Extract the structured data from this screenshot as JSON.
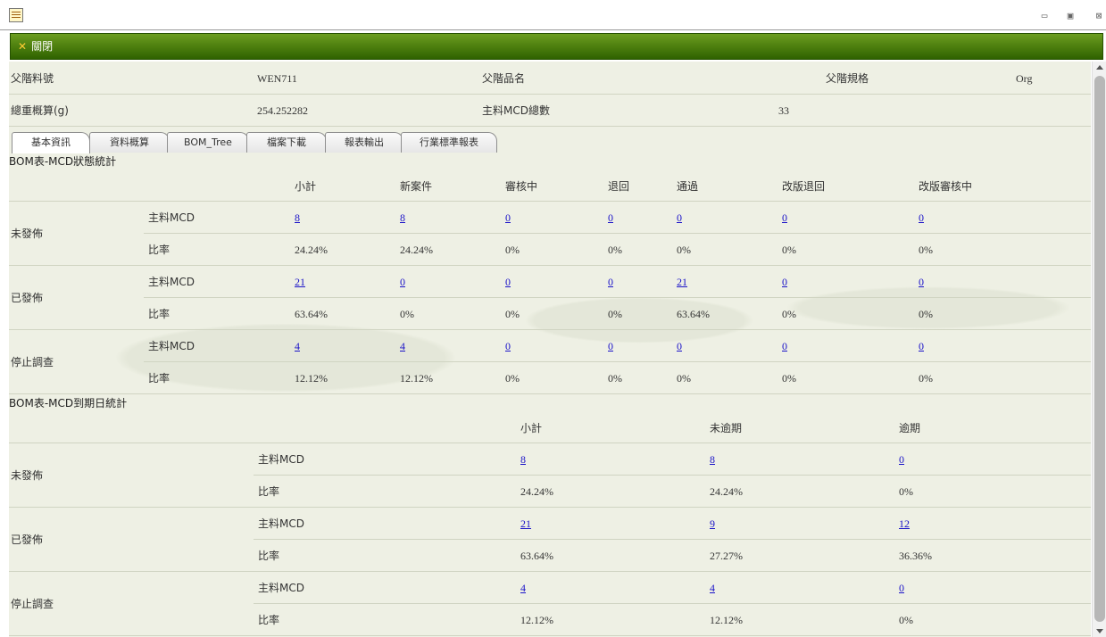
{
  "window": {
    "close_label": "關閉",
    "controls": [
      "pin-icon",
      "restore-icon",
      "close-window-icon"
    ]
  },
  "header": {
    "parent_part_no_label": "父階料號",
    "parent_part_no": "WEN711",
    "parent_part_name_label": "父階品名",
    "parent_spec_label": "父階規格",
    "org": "Org",
    "total_weight_label": "總重概算(g)",
    "total_weight": "254.252282",
    "mcd_total_label": "主料MCD總數",
    "mcd_total": "33"
  },
  "tabs": [
    "基本資訊",
    "資料概算",
    "BOM_Tree",
    "檔案下載",
    "報表輸出",
    "行業標準報表"
  ],
  "status_table": {
    "title": "BOM表-MCD狀態統計",
    "columns": [
      "小計",
      "新案件",
      "審核中",
      "退回",
      "通過",
      "改版退回",
      "改版審核中"
    ],
    "groups": [
      {
        "label": "未發佈",
        "mcd_label": "主料MCD",
        "mcd": [
          "8",
          "8",
          "0",
          "0",
          "0",
          "0",
          "0"
        ],
        "ratio_label": "比率",
        "ratio": [
          "24.24%",
          "24.24%",
          "0%",
          "0%",
          "0%",
          "0%",
          "0%"
        ]
      },
      {
        "label": "已發佈",
        "mcd_label": "主料MCD",
        "mcd": [
          "21",
          "0",
          "0",
          "0",
          "21",
          "0",
          "0"
        ],
        "ratio_label": "比率",
        "ratio": [
          "63.64%",
          "0%",
          "0%",
          "0%",
          "63.64%",
          "0%",
          "0%"
        ]
      },
      {
        "label": "停止調查",
        "mcd_label": "主料MCD",
        "mcd": [
          "4",
          "4",
          "0",
          "0",
          "0",
          "0",
          "0"
        ],
        "ratio_label": "比率",
        "ratio": [
          "12.12%",
          "12.12%",
          "0%",
          "0%",
          "0%",
          "0%",
          "0%"
        ]
      }
    ]
  },
  "due_table": {
    "title": "BOM表-MCD到期日統計",
    "columns": [
      "小計",
      "未逾期",
      "逾期"
    ],
    "groups": [
      {
        "label": "未發佈",
        "mcd_label": "主料MCD",
        "mcd": [
          "8",
          "8",
          "0"
        ],
        "ratio_label": "比率",
        "ratio": [
          "24.24%",
          "24.24%",
          "0%"
        ]
      },
      {
        "label": "已發佈",
        "mcd_label": "主料MCD",
        "mcd": [
          "21",
          "9",
          "12"
        ],
        "ratio_label": "比率",
        "ratio": [
          "63.64%",
          "27.27%",
          "36.36%"
        ]
      },
      {
        "label": "停止調查",
        "mcd_label": "主料MCD",
        "mcd": [
          "4",
          "4",
          "0"
        ],
        "ratio_label": "比率",
        "ratio": [
          "12.12%",
          "12.12%",
          "0%"
        ]
      }
    ]
  }
}
